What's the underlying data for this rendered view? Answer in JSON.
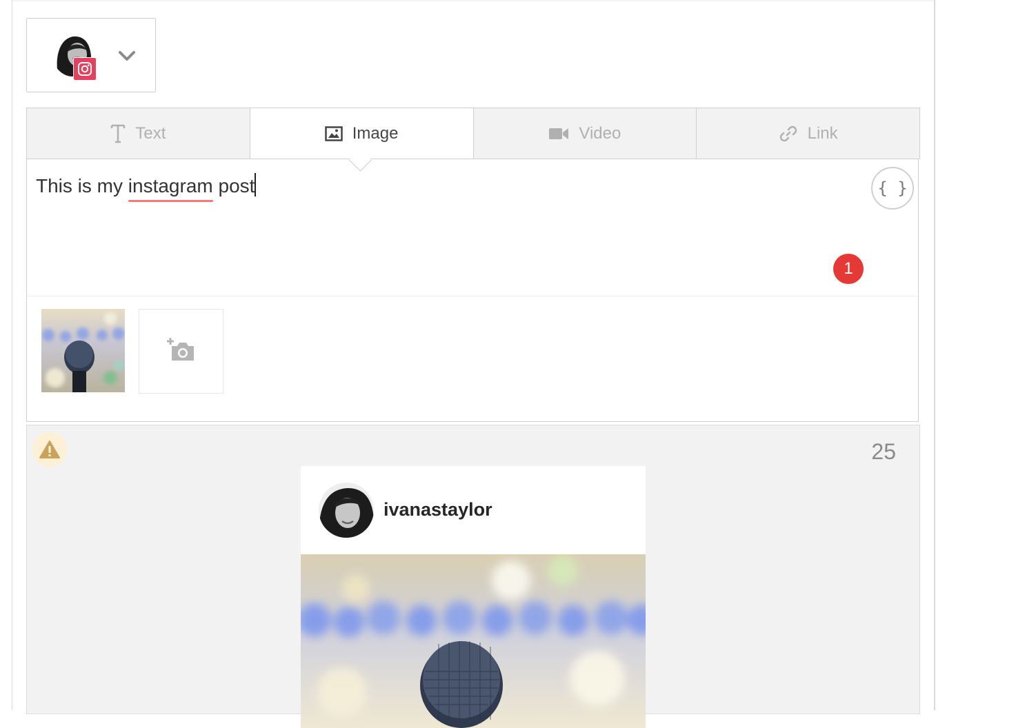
{
  "account": {
    "network_icon": "instagram-icon",
    "dropdown_icon": "chevron-down-icon"
  },
  "tabs": [
    {
      "label": "Text",
      "icon": "text-icon",
      "active": false
    },
    {
      "label": "Image",
      "icon": "image-icon",
      "active": true
    },
    {
      "label": "Video",
      "icon": "video-icon",
      "active": false
    },
    {
      "label": "Link",
      "icon": "link-icon",
      "active": false
    }
  ],
  "editor": {
    "text_before": "This is my ",
    "text_misspelled": "instagram",
    "text_after": " post",
    "variables_button": "{ }",
    "notification_count": "1"
  },
  "preview": {
    "warning_icon": "warning-icon",
    "char_count": "25",
    "username": "ivanastaylor"
  },
  "colors": {
    "instagram": "#e4405f",
    "badge": "#e53935",
    "warning_bg": "#fdf0d6",
    "warning_icon": "#c9a35a"
  }
}
